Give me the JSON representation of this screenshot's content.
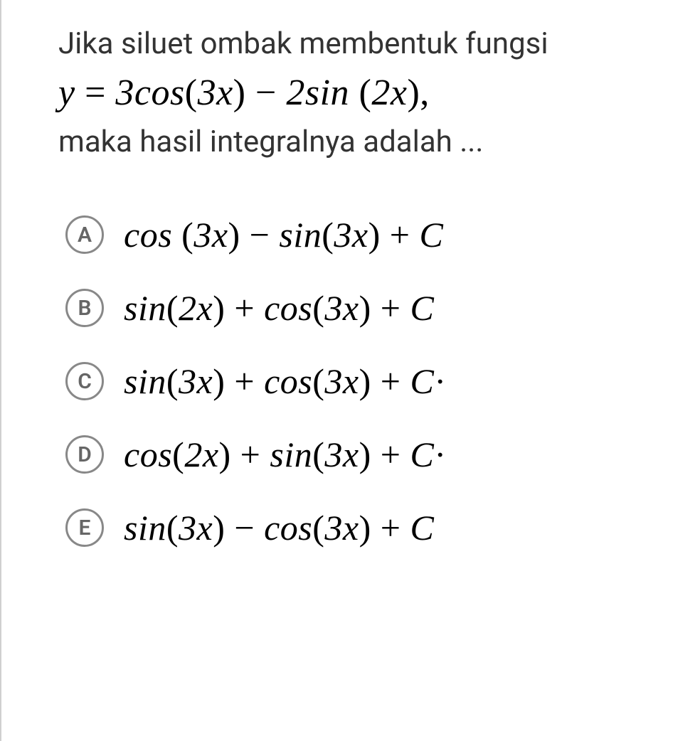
{
  "question": {
    "intro": "Jika siluet ombak membentuk fungsi",
    "equation_html": "<span class='upright'></span>y <span class='op'>=</span> 3cos<span class='paren'>(</span>3x<span class='paren'>)</span> <span class='op'>−</span> 2sin <span class='paren'>(</span>2x<span class='paren'>)</span><span class='comma'>,</span>",
    "tail": "maka hasil integralnya adalah ..."
  },
  "options": [
    {
      "letter": "A",
      "math_html": "cos <span class='paren'>(</span>3x<span class='paren'>)</span> <span class='op'>−</span> sin<span class='paren'>(</span>3x<span class='paren'>)</span> <span class='op'>+</span> C"
    },
    {
      "letter": "B",
      "math_html": "sin<span class='paren'>(</span>2x<span class='paren'>)</span> <span class='op'>+</span> cos<span class='paren'>(</span>3x<span class='paren'>)</span> <span class='op'>+</span> C"
    },
    {
      "letter": "C",
      "math_html": "sin<span class='paren'>(</span>3x<span class='paren'>)</span> <span class='op'>+</span> cos<span class='paren'>(</span>3x<span class='paren'>)</span> <span class='op'>+</span> C<span class='trail'>·</span>"
    },
    {
      "letter": "D",
      "math_html": "cos<span class='paren'>(</span>2x<span class='paren'>)</span> <span class='op'>+</span> sin<span class='paren'>(</span>3x<span class='paren'>)</span> <span class='op'>+</span> C<span class='trail'>·</span>"
    },
    {
      "letter": "E",
      "math_html": "sin<span class='paren'>(</span>3x<span class='paren'>)</span> <span class='op'>−</span> cos<span class='paren'>(</span>3x<span class='paren'>)</span> <span class='op'>+</span> C"
    }
  ]
}
